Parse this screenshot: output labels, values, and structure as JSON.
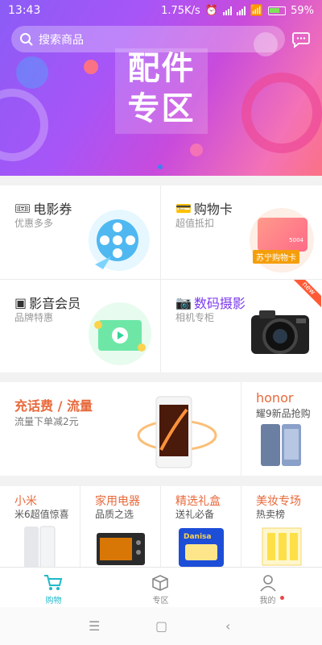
{
  "status_bar": {
    "time": "13:43",
    "speed": "1.75K/s",
    "battery": "59%"
  },
  "search": {
    "placeholder": "搜索商品"
  },
  "banner": {
    "title_line1": "配件",
    "title_line2": "专区"
  },
  "grid": [
    {
      "title": "电影券",
      "subtitle": "优惠多多"
    },
    {
      "title": "购物卡",
      "subtitle": "超值抵扣",
      "card_label": "苏宁购物卡",
      "card_code": "5004"
    },
    {
      "title": "影音会员",
      "subtitle": "品牌特惠"
    },
    {
      "title": "数码摄影",
      "subtitle": "相机专柜",
      "badge": "new"
    }
  ],
  "promo": {
    "left": {
      "title": "充话费 / 流量",
      "subtitle": "流量下单减2元"
    },
    "right": {
      "title": "honor",
      "subtitle": "耀9新品抢购"
    }
  },
  "categories": [
    {
      "title": "小米",
      "subtitle": "米6超值惊喜"
    },
    {
      "title": "家用电器",
      "subtitle": "品质之选"
    },
    {
      "title": "精选礼盒",
      "subtitle": "送礼必备",
      "product_brand": "Danisa"
    },
    {
      "title": "美妆专场",
      "subtitle": "热卖榜"
    }
  ],
  "tabs": [
    {
      "label": "购物",
      "icon": "cart-icon"
    },
    {
      "label": "专区",
      "icon": "box-icon"
    },
    {
      "label": "我的",
      "icon": "user-icon"
    }
  ],
  "colors": {
    "accent": "#1fb9c9",
    "orange": "#e8693b",
    "purple": "#7c3aed"
  }
}
